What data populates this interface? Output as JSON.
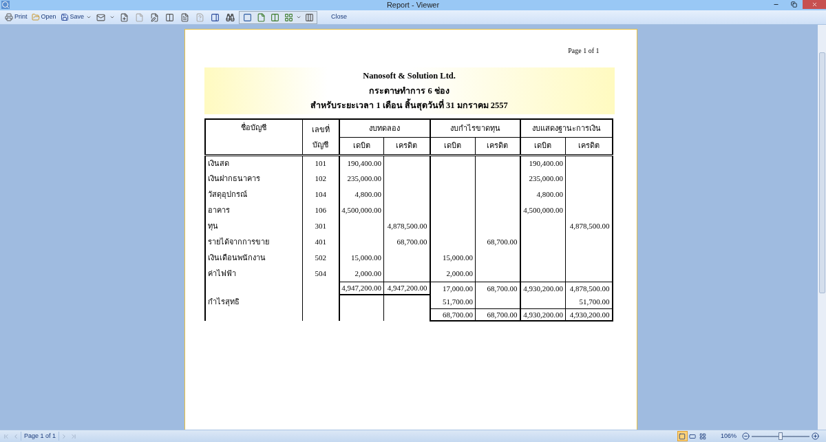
{
  "window": {
    "title": "Report - Viewer"
  },
  "toolbar": [
    {
      "kind": "print",
      "label": "Print"
    },
    {
      "kind": "open",
      "label": "Open"
    },
    {
      "kind": "save",
      "label": "Save"
    }
  ],
  "close_button": {
    "label": "Close"
  },
  "report": {
    "page_label": "Page 1 of 1",
    "header": [
      "Nanosoft & Solution Ltd.",
      "กระดาษทำการ 6 ช่อง",
      "สำหรับระยะเวลา  1 เดือน สิ้นสุดวันที่ 31 มกราคม 2557"
    ],
    "columns": {
      "name": "ชื่อบัญชี",
      "number": "เลขที่ บัญชี",
      "groups": [
        {
          "title": "งบทดลอง",
          "sub": [
            "เดบิต",
            "เครดิต"
          ]
        },
        {
          "title": "งบกำไรขาดทุน",
          "sub": [
            "เดบิต",
            "เครดิต"
          ]
        },
        {
          "title": "งบแสดงฐานะการเงิน",
          "sub": [
            "เดบิต",
            "เครดิต"
          ]
        }
      ]
    },
    "rows": [
      {
        "name": "เงินสด",
        "number": "101",
        "values": {
          "trial_debit": "190,400.00",
          "balance_debit": "190,400.00"
        }
      },
      {
        "name": "เงินฝากธนาคาร",
        "number": "102",
        "values": {
          "trial_debit": "235,000.00",
          "balance_debit": "235,000.00"
        }
      },
      {
        "name": "วัสดุอุปกรณ์",
        "number": "104",
        "values": {
          "trial_debit": "4,800.00",
          "balance_debit": "4,800.00"
        }
      },
      {
        "name": "อาคาร",
        "number": "106",
        "values": {
          "trial_debit": "4,500,000.00",
          "balance_debit": "4,500,000.00"
        }
      },
      {
        "name": "ทุน",
        "number": "301",
        "values": {
          "trial_credit": "4,878,500.00",
          "balance_credit": "4,878,500.00"
        }
      },
      {
        "name": "รายได้จากการขาย",
        "number": "401",
        "values": {
          "trial_credit": "68,700.00",
          "income_credit": "68,700.00"
        }
      },
      {
        "name": "เงินเดือนพนักงาน",
        "number": "502",
        "values": {
          "trial_debit": "15,000.00",
          "income_debit": "15,000.00"
        }
      },
      {
        "name": "ค่าไฟฟ้า",
        "number": "504",
        "values": {
          "trial_debit": "2,000.00",
          "income_debit": "2,000.00"
        }
      }
    ],
    "totals": {
      "trial_debit": "4,947,200.00",
      "trial_credit": "4,947,200.00",
      "income_debit": "17,000.00",
      "income_credit": "68,700.00",
      "balance_debit": "4,930,200.00",
      "balance_credit": "4,878,500.00"
    },
    "profit": {
      "name": "กำไรสุทธิ",
      "values": {
        "income_debit": "51,700.00",
        "balance_credit": "51,700.00"
      }
    },
    "final": {
      "income_debit": "68,700.00",
      "income_credit": "68,700.00",
      "balance_debit": "4,930,200.00",
      "balance_credit": "4,930,200.00"
    }
  },
  "status_bar": {
    "nav": [
      {
        "kind": "first",
        "disabled": true
      },
      {
        "kind": "prev",
        "disabled": true
      },
      {
        "kind": "next",
        "disabled": true
      },
      {
        "kind": "last",
        "disabled": true
      }
    ],
    "page": "Page 1 of 1",
    "views": [
      {
        "kind": "single",
        "selected": true
      },
      {
        "kind": "wide",
        "selected": false
      },
      {
        "kind": "multi",
        "selected": false
      }
    ],
    "zoom": "106%",
    "zoom_slider": {
      "level": 0.5
    }
  }
}
